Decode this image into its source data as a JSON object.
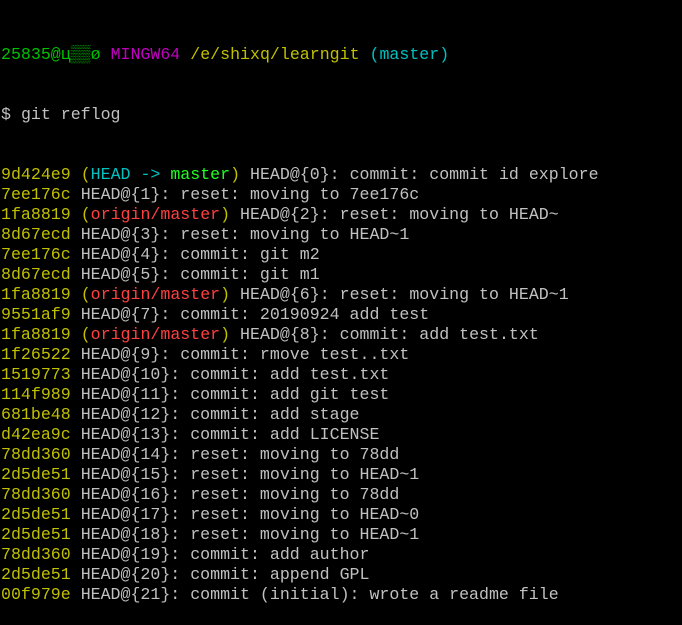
{
  "prompt": {
    "user_host": "25835@ц▒▒ø",
    "shell": "MINGW64",
    "path": "/e/shixq/learngit",
    "branch": "(master)",
    "symbol": "$",
    "command": "git reflog"
  },
  "colors": {
    "hash": "#c0c000",
    "head": "#00c0c0",
    "local_branch": "#20ff20",
    "remote_branch": "#ff4040",
    "text": "#c0c0c0",
    "background": "#000000"
  },
  "entries": [
    {
      "hash": "9d424e9",
      "ref_head": "HEAD -> ",
      "ref_branch": "master",
      "text": "HEAD@{0}: commit: commit id explore"
    },
    {
      "hash": "7ee176c",
      "text": "HEAD@{1}: reset: moving to 7ee176c"
    },
    {
      "hash": "1fa8819",
      "ref_remote": "origin/master",
      "text": "HEAD@{2}: reset: moving to HEAD~"
    },
    {
      "hash": "8d67ecd",
      "text": "HEAD@{3}: reset: moving to HEAD~1"
    },
    {
      "hash": "7ee176c",
      "text": "HEAD@{4}: commit: git m2"
    },
    {
      "hash": "8d67ecd",
      "text": "HEAD@{5}: commit: git m1"
    },
    {
      "hash": "1fa8819",
      "ref_remote": "origin/master",
      "text": "HEAD@{6}: reset: moving to HEAD~1"
    },
    {
      "hash": "9551af9",
      "text": "HEAD@{7}: commit: 20190924 add test"
    },
    {
      "hash": "1fa8819",
      "ref_remote": "origin/master",
      "text": "HEAD@{8}: commit: add test.txt"
    },
    {
      "hash": "1f26522",
      "text": "HEAD@{9}: commit: rmove test..txt"
    },
    {
      "hash": "1519773",
      "text": "HEAD@{10}: commit: add test.txt"
    },
    {
      "hash": "114f989",
      "text": "HEAD@{11}: commit: add git test"
    },
    {
      "hash": "681be48",
      "text": "HEAD@{12}: commit: add stage"
    },
    {
      "hash": "d42ea9c",
      "text": "HEAD@{13}: commit: add LICENSE"
    },
    {
      "hash": "78dd360",
      "text": "HEAD@{14}: reset: moving to 78dd"
    },
    {
      "hash": "2d5de51",
      "text": "HEAD@{15}: reset: moving to HEAD~1"
    },
    {
      "hash": "78dd360",
      "text": "HEAD@{16}: reset: moving to 78dd"
    },
    {
      "hash": "2d5de51",
      "text": "HEAD@{17}: reset: moving to HEAD~0"
    },
    {
      "hash": "2d5de51",
      "text": "HEAD@{18}: reset: moving to HEAD~1"
    },
    {
      "hash": "78dd360",
      "text": "HEAD@{19}: commit: add author"
    },
    {
      "hash": "2d5de51",
      "text": "HEAD@{20}: commit: append GPL"
    },
    {
      "hash": "00f979e",
      "text": "HEAD@{21}: commit (initial): wrote a readme file"
    }
  ]
}
